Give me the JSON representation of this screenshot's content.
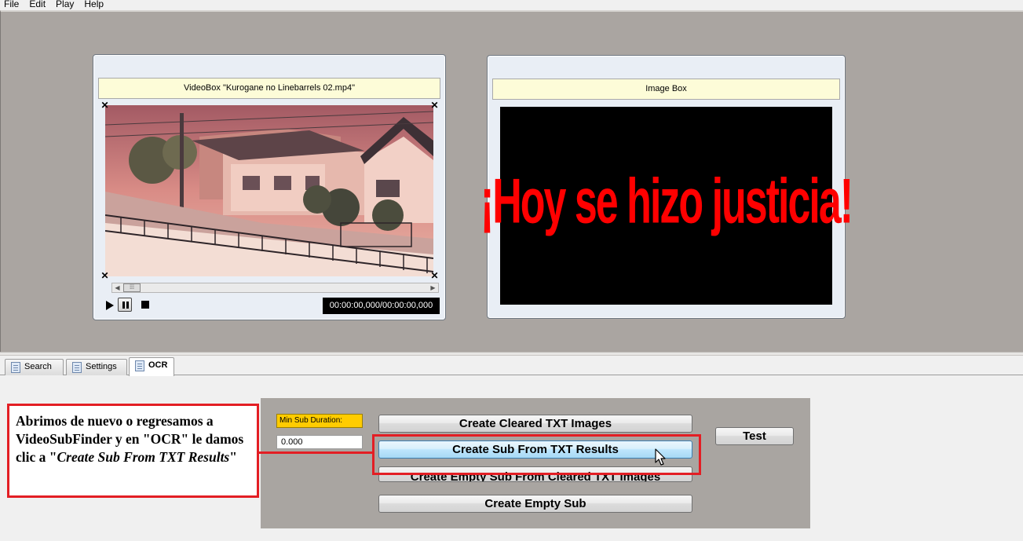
{
  "menu": [
    "File",
    "Edit",
    "Play",
    "Help"
  ],
  "video_box": {
    "title": "VideoBox \"Kurogane no Linebarrels 02.mp4\"",
    "timecode": "00:00:00,000/00:00:00,000"
  },
  "image_box": {
    "title": "Image Box",
    "subtitle_text": "¡Hoy se hizo justicia!"
  },
  "tabs": [
    {
      "label": "Search",
      "active": false
    },
    {
      "label": "Settings",
      "active": false
    },
    {
      "label": "OCR",
      "active": true
    }
  ],
  "ocr": {
    "min_sub_duration_label": "Min Sub Duration:",
    "min_sub_duration_value": "0.000",
    "buttons": {
      "create_cleared": "Create Cleared TXT Images",
      "create_from_txt": "Create Sub From TXT Results",
      "create_empty_from_cleared": "Create Empty Sub From Cleared TXT Images",
      "create_empty": "Create Empty Sub",
      "test": "Test"
    }
  },
  "annotation": {
    "text_main": "Abrimos de nuevo o regresamos a VideoSubFinder y en \"OCR\" le damos clic a \"",
    "text_italic": "Create Sub From TXT Results",
    "text_end": "\""
  },
  "colors": {
    "annotation_red": "#e31e24",
    "subtitle_red": "#ff0000",
    "panel_gray": "#a9a5a1",
    "label_yellow": "#ffcc00"
  }
}
